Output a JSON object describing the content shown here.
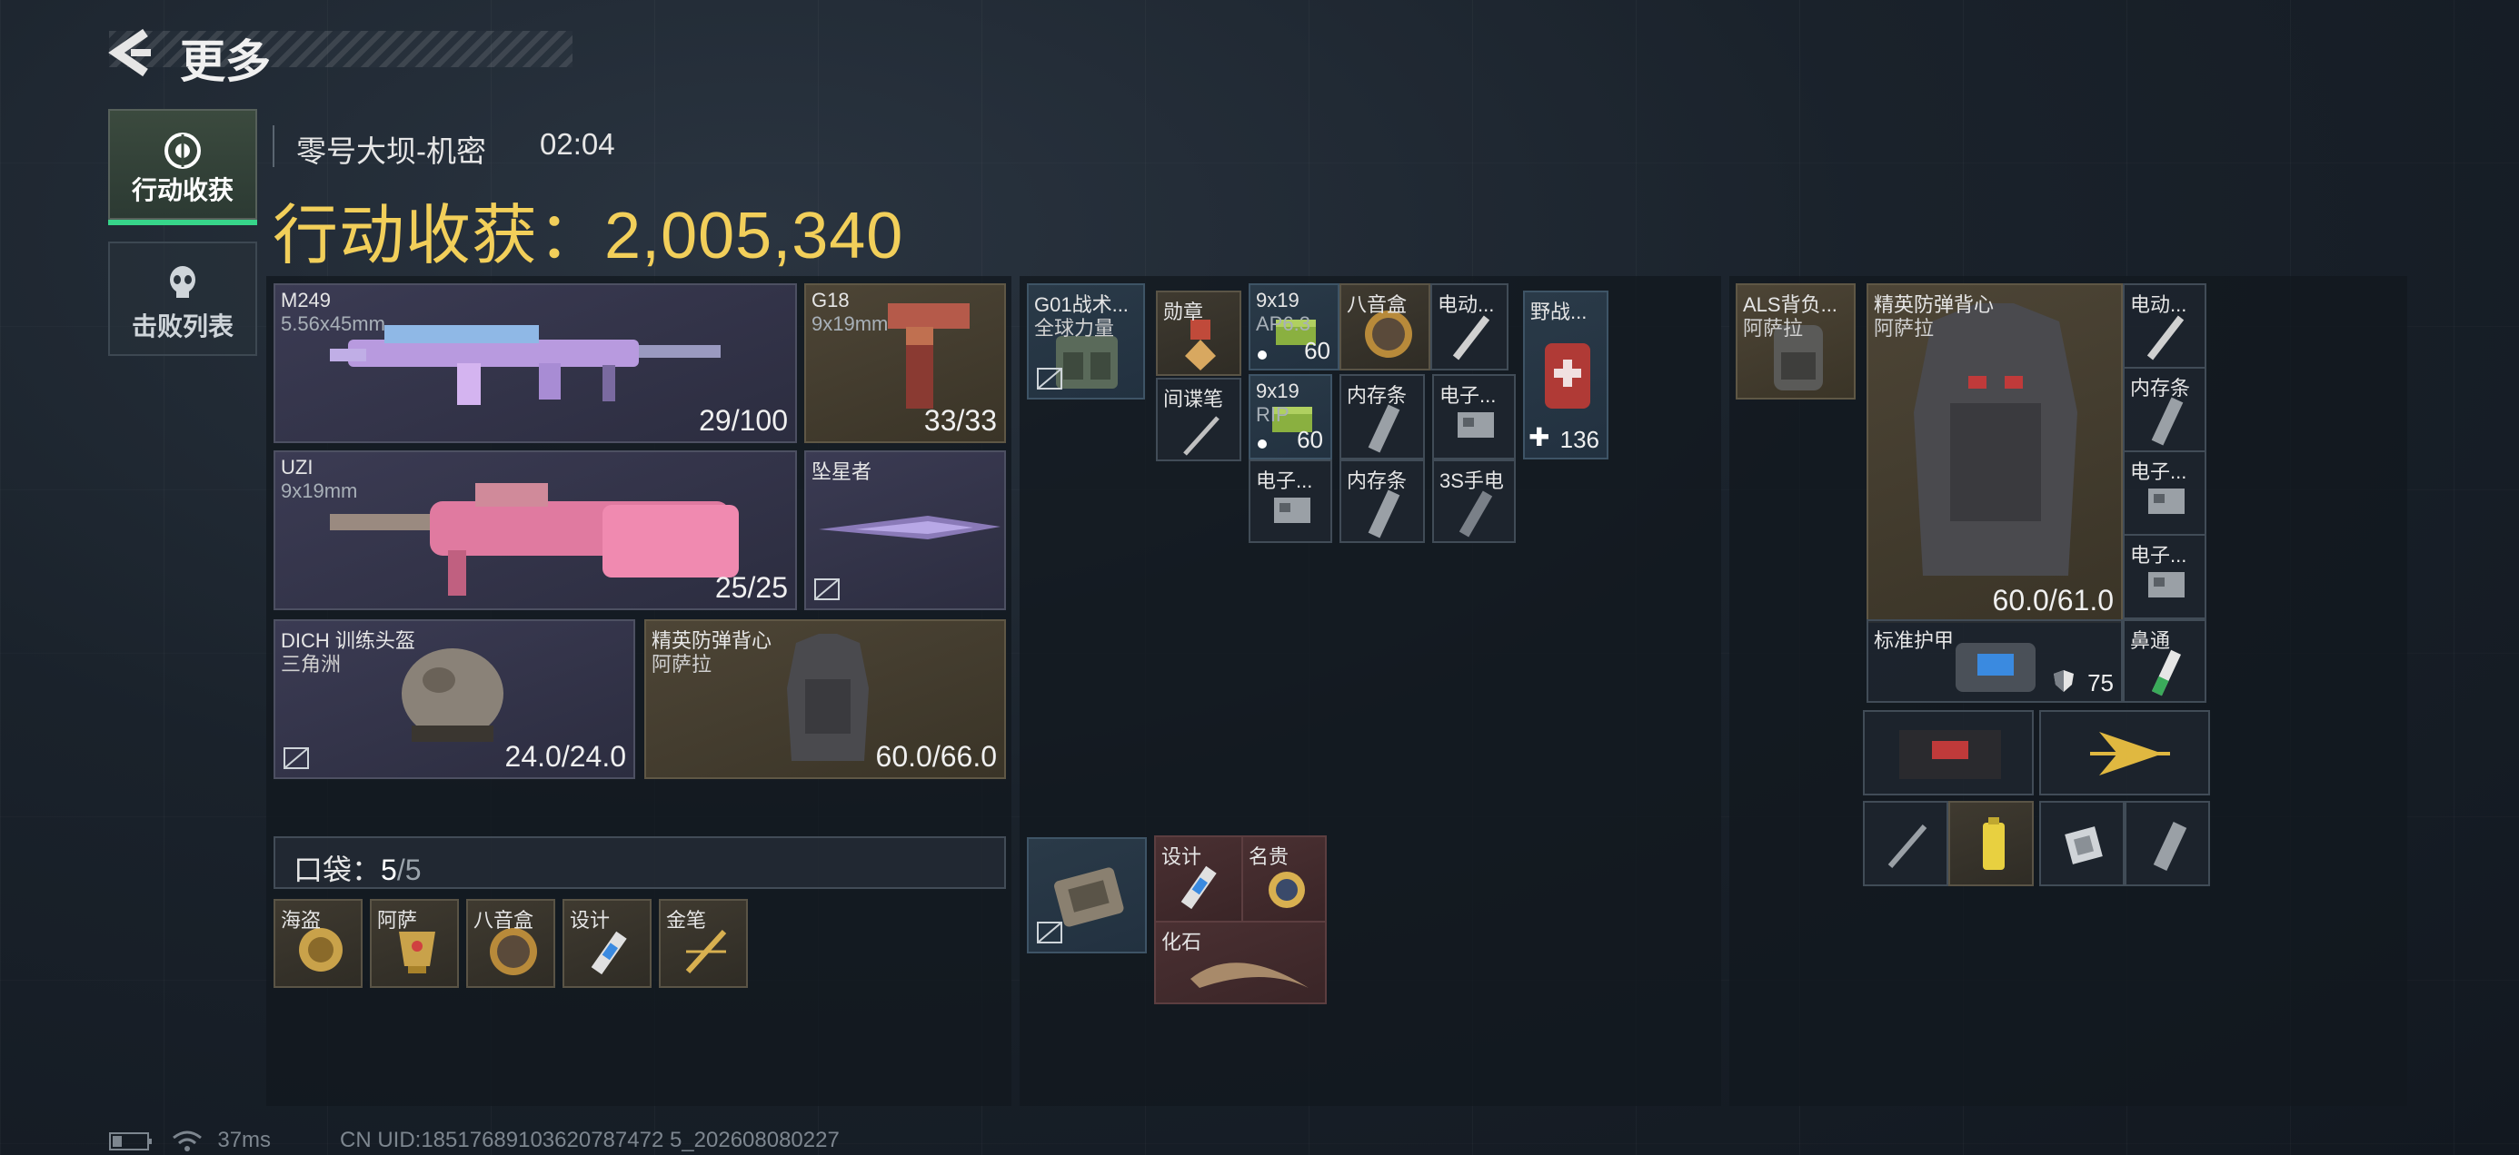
{
  "header": {
    "title": "更多"
  },
  "side_tabs": [
    {
      "label": "行动收获",
      "icon": "loot-icon",
      "active": true
    },
    {
      "label": "击败列表",
      "icon": "skull-icon",
      "active": false
    }
  ],
  "match": {
    "map": "零号大坝-机密",
    "time": "02:04",
    "earnings_label": "行动收获：",
    "earnings_value": "2,005,340"
  },
  "weapons": {
    "primary1": {
      "name": "M249",
      "ammo": "5.56x45mm",
      "count": "29/100"
    },
    "sidearm": {
      "name": "G18",
      "ammo": "9x19mm",
      "count": "33/33"
    },
    "primary2": {
      "name": "UZI",
      "ammo": "9x19mm",
      "count": "25/25"
    },
    "melee": {
      "name": "坠星者"
    },
    "helmet": {
      "name": "DICH 训练头盔",
      "brand": "三角洲",
      "durability": "24.0/24.0"
    },
    "armor": {
      "name": "精英防弹背心",
      "brand": "阿萨拉",
      "durability": "60.0/66.0"
    }
  },
  "pockets": {
    "label": "口袋：",
    "used": "5",
    "total": "/5",
    "items": [
      "海盗",
      "阿萨",
      "八音盒",
      "设计",
      "金笔"
    ]
  },
  "rig": {
    "name": "G01战术...",
    "brand": "全球力量",
    "items": [
      {
        "name": "勋章"
      },
      {
        "name": "间谍笔"
      },
      {
        "name": "9x19",
        "sub": "AP6.3",
        "count": "60"
      },
      {
        "name": "八音盒"
      },
      {
        "name": "电动..."
      },
      {
        "name": "9x19",
        "sub": "RIP",
        "count": "60"
      },
      {
        "name": "内存条"
      },
      {
        "name": "电子..."
      },
      {
        "name": "电子..."
      },
      {
        "name": "内存条"
      },
      {
        "name": "3S手电"
      }
    ],
    "medkit": {
      "name": "野战...",
      "count": "136"
    }
  },
  "safebox": {
    "items": [
      {
        "name": "设计"
      },
      {
        "name": "名贵"
      },
      {
        "name": "化石"
      }
    ]
  },
  "backpack": {
    "name": "ALS背负...",
    "brand": "阿萨拉",
    "vest": {
      "name": "精英防弹背心",
      "brand": "阿萨拉",
      "durability": "60.0/61.0"
    },
    "side_items": [
      "电动...",
      "内存条",
      "电子...",
      "电子..."
    ],
    "plate": {
      "name": "标准护甲",
      "count": "75"
    },
    "spray": {
      "name": "鼻通"
    }
  },
  "status": {
    "ping": "37ms",
    "uid": "CN UID:18517689103620787472 5_202608080227"
  }
}
